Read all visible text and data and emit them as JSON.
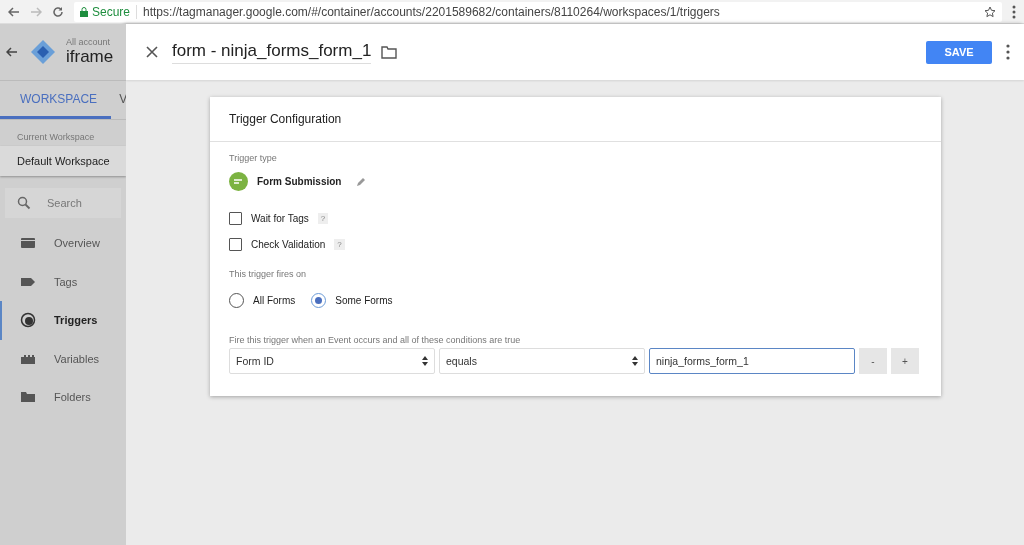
{
  "browser": {
    "secure_label": "Secure",
    "url": "https://tagmanager.google.com/#/container/accounts/2201589682/containers/8110264/workspaces/1/triggers"
  },
  "sidebar": {
    "account_label": "All account",
    "container_name": "iframe",
    "tabs": [
      {
        "label": "WORKSPACE",
        "selected": true
      },
      {
        "label": "V",
        "selected": false
      }
    ],
    "workspace_label": "Current Workspace",
    "workspace_name": "Default Workspace",
    "search_placeholder": "Search",
    "items": [
      {
        "label": "Overview",
        "kind": "overview",
        "selected": false
      },
      {
        "label": "Tags",
        "kind": "tags",
        "selected": false
      },
      {
        "label": "Triggers",
        "kind": "triggers",
        "selected": true
      },
      {
        "label": "Variables",
        "kind": "variables",
        "selected": false
      },
      {
        "label": "Folders",
        "kind": "folders",
        "selected": false
      }
    ]
  },
  "panel": {
    "title": "form - ninja_forms_form_1",
    "save_button": "SAVE",
    "card": {
      "title": "Trigger Configuration",
      "trigger_type_label": "Trigger type",
      "trigger_type": "Form Submission",
      "options": [
        {
          "label": "Wait for Tags",
          "checked": false,
          "help": "?"
        },
        {
          "label": "Check Validation",
          "checked": false,
          "help": "?"
        }
      ],
      "fires_on_label": "This trigger fires on",
      "fires_on": [
        {
          "label": "All Forms",
          "selected": false
        },
        {
          "label": "Some Forms",
          "selected": true
        }
      ],
      "condition_label": "Fire this trigger when an Event occurs and all of these conditions are true",
      "condition": {
        "variable": "Form ID",
        "operator": "equals",
        "value": "ninja_forms_form_1",
        "remove_button": "-",
        "add_button": "+"
      }
    }
  }
}
